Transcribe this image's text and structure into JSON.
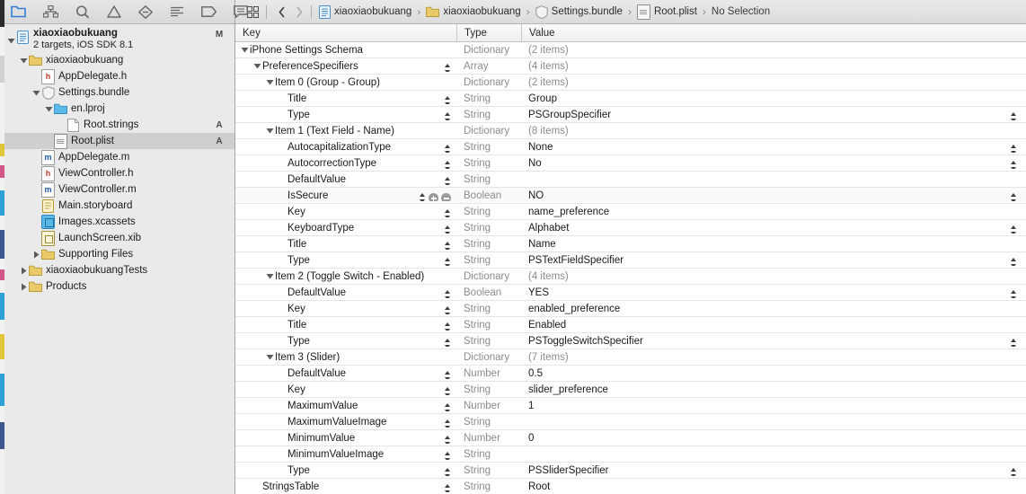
{
  "navigator": {
    "toolbar_icons": [
      {
        "name": "project-navigator-icon",
        "label": "Project",
        "active": true
      },
      {
        "name": "symbol-navigator-icon",
        "label": "Symbol",
        "active": false
      },
      {
        "name": "search-navigator-icon",
        "label": "Find",
        "active": false
      },
      {
        "name": "issue-navigator-icon",
        "label": "Issues",
        "active": false
      },
      {
        "name": "test-navigator-icon",
        "label": "Test",
        "active": false
      },
      {
        "name": "debug-navigator-icon",
        "label": "Debug",
        "active": false
      },
      {
        "name": "breakpoint-navigator-icon",
        "label": "Breakpoints",
        "active": false
      },
      {
        "name": "report-navigator-icon",
        "label": "Reports",
        "active": false
      }
    ],
    "tree": [
      {
        "label": "xiaoxiaobukuang",
        "sub": "2 targets, iOS SDK 8.1",
        "icon": "xcode-project-icon",
        "indent": 0,
        "twisty": "down",
        "badge": "M",
        "selected": false,
        "type": "project"
      },
      {
        "label": "xiaoxiaobukuang",
        "sub": "",
        "icon": "folder-icon",
        "indent": 1,
        "twisty": "down",
        "badge": "",
        "selected": false,
        "type": "group"
      },
      {
        "label": "AppDelegate.h",
        "sub": "",
        "icon": "header-file-icon",
        "indent": 2,
        "twisty": "none",
        "badge": "",
        "selected": false,
        "type": "file"
      },
      {
        "label": "Settings.bundle",
        "sub": "",
        "icon": "bundle-icon",
        "indent": 2,
        "twisty": "down",
        "badge": "",
        "selected": false,
        "type": "bundle"
      },
      {
        "label": "en.lproj",
        "sub": "",
        "icon": "blue-folder-icon",
        "indent": 3,
        "twisty": "down",
        "badge": "",
        "selected": false,
        "type": "group"
      },
      {
        "label": "Root.strings",
        "sub": "",
        "icon": "strings-file-icon",
        "indent": 4,
        "twisty": "none",
        "badge": "A",
        "selected": false,
        "type": "file"
      },
      {
        "label": "Root.plist",
        "sub": "",
        "icon": "plist-file-icon",
        "indent": 3,
        "twisty": "none",
        "badge": "A",
        "selected": true,
        "type": "file"
      },
      {
        "label": "AppDelegate.m",
        "sub": "",
        "icon": "source-file-icon",
        "indent": 2,
        "twisty": "none",
        "badge": "",
        "selected": false,
        "type": "file"
      },
      {
        "label": "ViewController.h",
        "sub": "",
        "icon": "header-file-icon",
        "indent": 2,
        "twisty": "none",
        "badge": "",
        "selected": false,
        "type": "file"
      },
      {
        "label": "ViewController.m",
        "sub": "",
        "icon": "source-file-icon",
        "indent": 2,
        "twisty": "none",
        "badge": "",
        "selected": false,
        "type": "file"
      },
      {
        "label": "Main.storyboard",
        "sub": "",
        "icon": "storyboard-icon",
        "indent": 2,
        "twisty": "none",
        "badge": "",
        "selected": false,
        "type": "file"
      },
      {
        "label": "Images.xcassets",
        "sub": "",
        "icon": "assets-catalog-icon",
        "indent": 2,
        "twisty": "none",
        "badge": "",
        "selected": false,
        "type": "file"
      },
      {
        "label": "LaunchScreen.xib",
        "sub": "",
        "icon": "xib-icon",
        "indent": 2,
        "twisty": "none",
        "badge": "",
        "selected": false,
        "type": "file"
      },
      {
        "label": "Supporting Files",
        "sub": "",
        "icon": "folder-icon",
        "indent": 2,
        "twisty": "right",
        "badge": "",
        "selected": false,
        "type": "group"
      },
      {
        "label": "xiaoxiaobukuangTests",
        "sub": "",
        "icon": "folder-icon",
        "indent": 1,
        "twisty": "right",
        "badge": "",
        "selected": false,
        "type": "group"
      },
      {
        "label": "Products",
        "sub": "",
        "icon": "folder-icon",
        "indent": 1,
        "twisty": "right",
        "badge": "",
        "selected": false,
        "type": "group"
      }
    ]
  },
  "jumpbar": {
    "related_items_icon": "related-items-icon",
    "back_arrow": "‹",
    "forward_arrow": "›",
    "separator": "›",
    "crumbs": [
      {
        "label": "xiaoxiaobukuang",
        "icon": "xcode-project-icon"
      },
      {
        "label": "xiaoxiaobukuang",
        "icon": "folder-icon"
      },
      {
        "label": "Settings.bundle",
        "icon": "bundle-icon"
      },
      {
        "label": "Root.plist",
        "icon": "plist-file-icon"
      },
      {
        "label": "No Selection",
        "icon": "none"
      }
    ]
  },
  "plist": {
    "columns": [
      "Key",
      "Type",
      "Value"
    ],
    "rows": [
      {
        "key": "iPhone Settings Schema",
        "indent": 0,
        "twisty": "down",
        "type": "Dictionary",
        "value": "(2 items)",
        "is_items": true,
        "key_stepper": false,
        "val_stepper": false,
        "hover": false
      },
      {
        "key": "PreferenceSpecifiers",
        "indent": 1,
        "twisty": "down",
        "type": "Array",
        "value": "(4 items)",
        "is_items": true,
        "key_stepper": true,
        "val_stepper": false,
        "hover": false
      },
      {
        "key": "Item 0 (Group - Group)",
        "indent": 2,
        "twisty": "down",
        "type": "Dictionary",
        "value": "(2 items)",
        "is_items": true,
        "key_stepper": false,
        "val_stepper": false,
        "hover": false
      },
      {
        "key": "Title",
        "indent": 3,
        "twisty": "none",
        "type": "String",
        "value": "Group",
        "is_items": false,
        "key_stepper": true,
        "val_stepper": false,
        "hover": false
      },
      {
        "key": "Type",
        "indent": 3,
        "twisty": "none",
        "type": "String",
        "value": "PSGroupSpecifier",
        "is_items": false,
        "key_stepper": true,
        "val_stepper": true,
        "hover": false
      },
      {
        "key": "Item 1 (Text Field - Name)",
        "indent": 2,
        "twisty": "down",
        "type": "Dictionary",
        "value": "(8 items)",
        "is_items": true,
        "key_stepper": false,
        "val_stepper": false,
        "hover": false
      },
      {
        "key": "AutocapitalizationType",
        "indent": 3,
        "twisty": "none",
        "type": "String",
        "value": "None",
        "is_items": false,
        "key_stepper": true,
        "val_stepper": true,
        "hover": false
      },
      {
        "key": "AutocorrectionType",
        "indent": 3,
        "twisty": "none",
        "type": "String",
        "value": "No",
        "is_items": false,
        "key_stepper": true,
        "val_stepper": true,
        "hover": false
      },
      {
        "key": "DefaultValue",
        "indent": 3,
        "twisty": "none",
        "type": "String",
        "value": "",
        "is_items": false,
        "key_stepper": true,
        "val_stepper": false,
        "hover": false
      },
      {
        "key": "IsSecure",
        "indent": 3,
        "twisty": "none",
        "type": "Boolean",
        "value": "NO",
        "is_items": false,
        "key_stepper": true,
        "val_stepper": true,
        "hover": true,
        "show_add_remove": true
      },
      {
        "key": "Key",
        "indent": 3,
        "twisty": "none",
        "type": "String",
        "value": "name_preference",
        "is_items": false,
        "key_stepper": true,
        "val_stepper": false,
        "hover": false
      },
      {
        "key": "KeyboardType",
        "indent": 3,
        "twisty": "none",
        "type": "String",
        "value": "Alphabet",
        "is_items": false,
        "key_stepper": true,
        "val_stepper": true,
        "hover": false
      },
      {
        "key": "Title",
        "indent": 3,
        "twisty": "none",
        "type": "String",
        "value": "Name",
        "is_items": false,
        "key_stepper": true,
        "val_stepper": false,
        "hover": false
      },
      {
        "key": "Type",
        "indent": 3,
        "twisty": "none",
        "type": "String",
        "value": "PSTextFieldSpecifier",
        "is_items": false,
        "key_stepper": true,
        "val_stepper": true,
        "hover": false
      },
      {
        "key": "Item 2 (Toggle Switch - Enabled)",
        "indent": 2,
        "twisty": "down",
        "type": "Dictionary",
        "value": "(4 items)",
        "is_items": true,
        "key_stepper": false,
        "val_stepper": false,
        "hover": false
      },
      {
        "key": "DefaultValue",
        "indent": 3,
        "twisty": "none",
        "type": "Boolean",
        "value": "YES",
        "is_items": false,
        "key_stepper": true,
        "val_stepper": true,
        "hover": false
      },
      {
        "key": "Key",
        "indent": 3,
        "twisty": "none",
        "type": "String",
        "value": "enabled_preference",
        "is_items": false,
        "key_stepper": true,
        "val_stepper": false,
        "hover": false
      },
      {
        "key": "Title",
        "indent": 3,
        "twisty": "none",
        "type": "String",
        "value": "Enabled",
        "is_items": false,
        "key_stepper": true,
        "val_stepper": false,
        "hover": false
      },
      {
        "key": "Type",
        "indent": 3,
        "twisty": "none",
        "type": "String",
        "value": "PSToggleSwitchSpecifier",
        "is_items": false,
        "key_stepper": true,
        "val_stepper": true,
        "hover": false
      },
      {
        "key": "Item 3 (Slider)",
        "indent": 2,
        "twisty": "down",
        "type": "Dictionary",
        "value": "(7 items)",
        "is_items": true,
        "key_stepper": false,
        "val_stepper": false,
        "hover": false
      },
      {
        "key": "DefaultValue",
        "indent": 3,
        "twisty": "none",
        "type": "Number",
        "value": "0.5",
        "is_items": false,
        "key_stepper": true,
        "val_stepper": false,
        "hover": false
      },
      {
        "key": "Key",
        "indent": 3,
        "twisty": "none",
        "type": "String",
        "value": "slider_preference",
        "is_items": false,
        "key_stepper": true,
        "val_stepper": false,
        "hover": false
      },
      {
        "key": "MaximumValue",
        "indent": 3,
        "twisty": "none",
        "type": "Number",
        "value": "1",
        "is_items": false,
        "key_stepper": true,
        "val_stepper": false,
        "hover": false
      },
      {
        "key": "MaximumValueImage",
        "indent": 3,
        "twisty": "none",
        "type": "String",
        "value": "",
        "is_items": false,
        "key_stepper": true,
        "val_stepper": false,
        "hover": false
      },
      {
        "key": "MinimumValue",
        "indent": 3,
        "twisty": "none",
        "type": "Number",
        "value": "0",
        "is_items": false,
        "key_stepper": true,
        "val_stepper": false,
        "hover": false
      },
      {
        "key": "MinimumValueImage",
        "indent": 3,
        "twisty": "none",
        "type": "String",
        "value": "",
        "is_items": false,
        "key_stepper": true,
        "val_stepper": false,
        "hover": false
      },
      {
        "key": "Type",
        "indent": 3,
        "twisty": "none",
        "type": "String",
        "value": "PSSliderSpecifier",
        "is_items": false,
        "key_stepper": true,
        "val_stepper": true,
        "hover": false
      },
      {
        "key": "StringsTable",
        "indent": 1,
        "twisty": "none",
        "type": "String",
        "value": "Root",
        "is_items": false,
        "key_stepper": true,
        "val_stepper": false,
        "hover": false
      }
    ]
  },
  "colors": {
    "accent": "#2f7fd6",
    "selected_row": "#cfcfcf",
    "navigator_bg": "#eaeaea",
    "toolbar_bg": "#e1e1e1",
    "dim_text": "#8c8c8c"
  }
}
